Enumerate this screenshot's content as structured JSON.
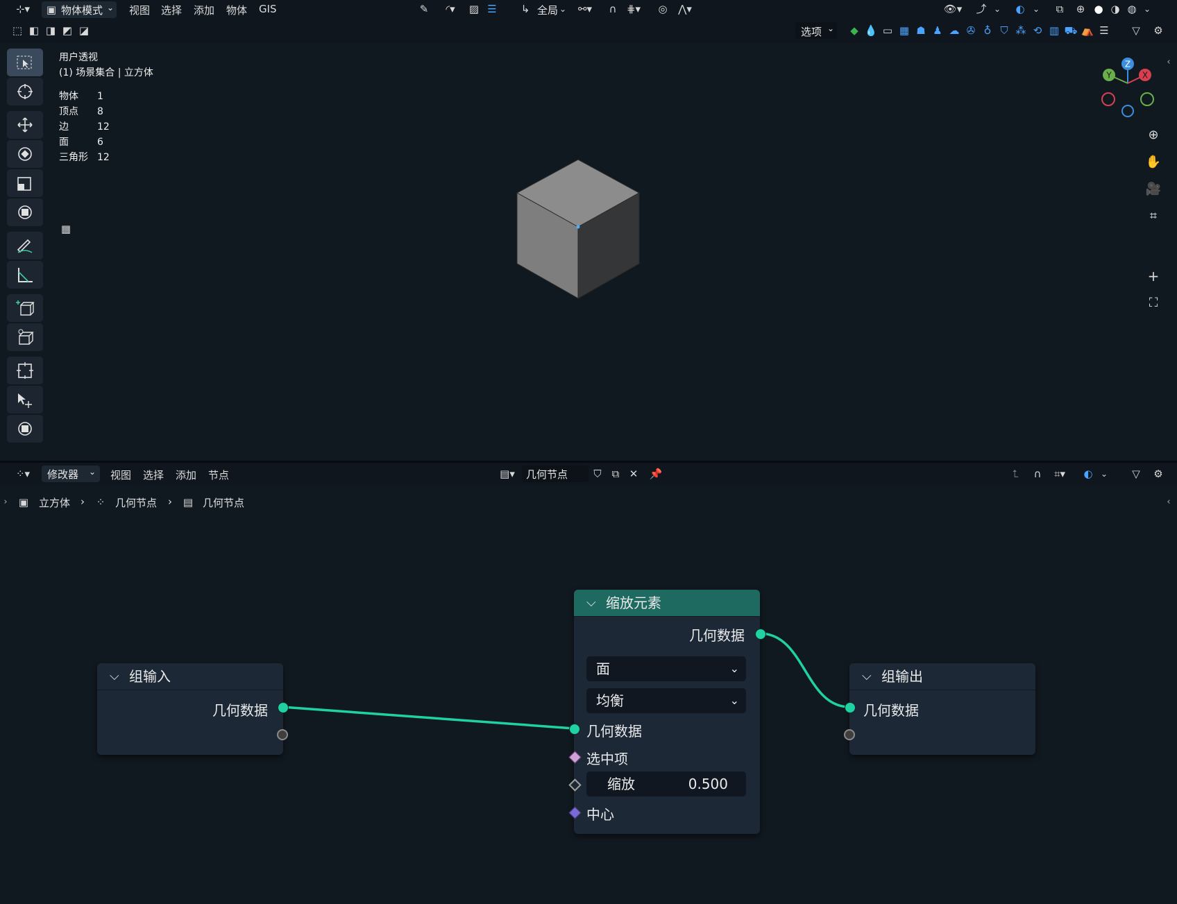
{
  "header": {
    "mode_label": "物体模式",
    "menus": [
      "视图",
      "选择",
      "添加",
      "物体",
      "GIS"
    ],
    "orientation_label": "全局",
    "options_label": "选项"
  },
  "viewport": {
    "view_name": "用户透视",
    "collection_line": "(1) 场景集合 | 立方体",
    "stats": [
      {
        "label": "物体",
        "value": "1"
      },
      {
        "label": "顶点",
        "value": "8"
      },
      {
        "label": "边",
        "value": "12"
      },
      {
        "label": "面",
        "value": "6"
      },
      {
        "label": "三角形",
        "value": "12"
      }
    ],
    "gizmo": {
      "z": "Z",
      "y": "Y",
      "x": "X"
    }
  },
  "node_editor": {
    "editor_type_label": "修改器",
    "menus": [
      "视图",
      "选择",
      "添加",
      "节点"
    ],
    "node_tree_name": "几何节点",
    "breadcrumb": [
      "立方体",
      "几何节点",
      "几何节点"
    ],
    "nodes": {
      "group_input": {
        "title": "组输入",
        "output": "几何数据"
      },
      "scale_elements": {
        "title": "缩放元素",
        "output": "几何数据",
        "domain": "面",
        "mode": "均衡",
        "input_geometry": "几何数据",
        "selection": "选中项",
        "scale_label": "缩放",
        "scale_value": "0.500",
        "center": "中心"
      },
      "group_output": {
        "title": "组输出",
        "input": "几何数据"
      }
    }
  },
  "colors": {
    "geometry_socket": "#1fd1a3",
    "scale_node_header": "#1e6a60",
    "selection_socket": "#d0a0d8",
    "vector_socket": "#7a6ad8",
    "float_socket": "#a0a0a0"
  }
}
